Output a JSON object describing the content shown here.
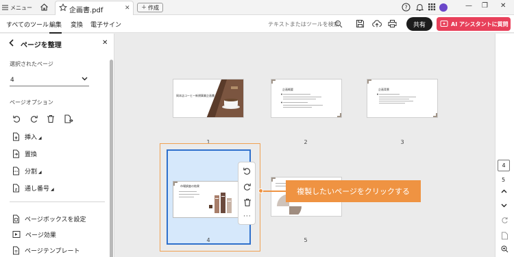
{
  "titlebar": {
    "menu_label": "メニュー",
    "tab_title": "企画書.pdf",
    "create_label": "作成"
  },
  "toolbar": {
    "menus": [
      "すべてのツール",
      "編集",
      "変換",
      "電子サイン"
    ],
    "search_placeholder": "テキストまたはツールを検索",
    "share_label": "共有",
    "ai_label": "AI アシスタントに質問"
  },
  "sidebar": {
    "title": "ページを整理",
    "selected_pages_label": "選択されたページ",
    "selected_page_value": "4",
    "page_options_label": "ページオプション",
    "items": [
      {
        "label": "挿入",
        "icon": "insert-page-icon"
      },
      {
        "label": "置換",
        "icon": "replace-page-icon"
      },
      {
        "label": "分割",
        "icon": "split-icon"
      },
      {
        "label": "通し番号",
        "icon": "numbering-icon"
      }
    ],
    "items2": [
      {
        "label": "ページボックスを設定",
        "icon": "page-box-icon"
      },
      {
        "label": "ページ効果",
        "icon": "page-effect-icon"
      },
      {
        "label": "ページテンプレート",
        "icon": "page-template-icon"
      }
    ]
  },
  "pages": [
    {
      "number": "1",
      "title": "岡本店コーヒー新規事業企画書",
      "kind": "cover"
    },
    {
      "number": "2",
      "title": "企画概要",
      "kind": "text"
    },
    {
      "number": "3",
      "title": "企画背景",
      "kind": "text"
    },
    {
      "number": "4",
      "title": "市場調査の結果",
      "kind": "chart",
      "selected": true
    },
    {
      "number": "5",
      "title": "",
      "kind": "pie"
    }
  ],
  "callout": {
    "text": "複製したいページをクリックする",
    "color": "#ef9342"
  },
  "rail": {
    "current_page": "4",
    "total_pages": "5"
  },
  "colors": {
    "accent_ai": "#e8405a",
    "selection_border": "#2d6fcc",
    "selection_fill": "#d6e8fb",
    "selection_outline": "#f0a050"
  }
}
